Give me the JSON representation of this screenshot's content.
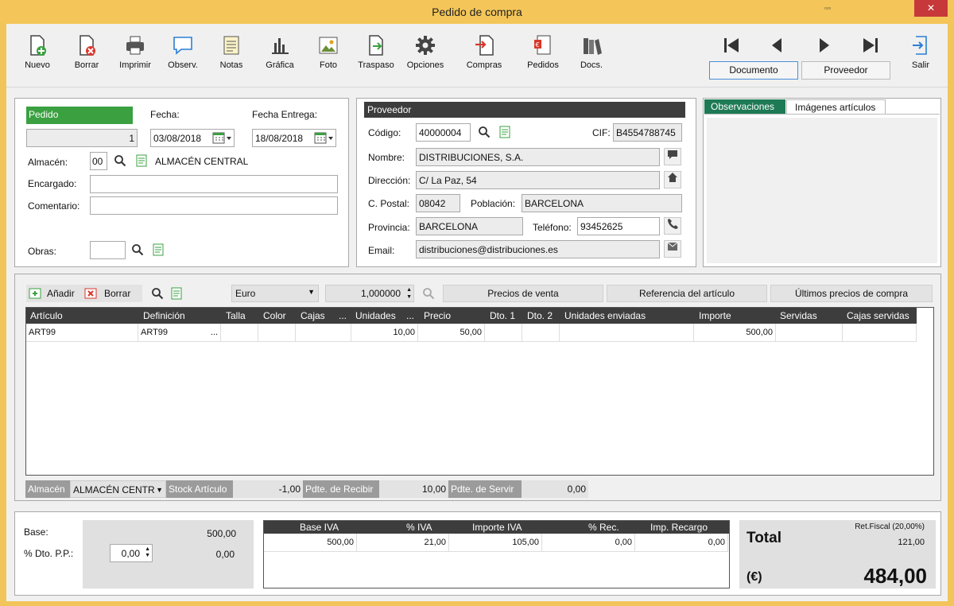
{
  "window": {
    "title": "Pedido de compra",
    "restore_glyph": "▫▫▫",
    "close_glyph": "✕"
  },
  "toolbar": {
    "items": [
      {
        "label": "Nuevo",
        "icon": "new-document-icon"
      },
      {
        "label": "Borrar",
        "icon": "delete-document-icon"
      },
      {
        "label": "Imprimir",
        "icon": "printer-icon"
      },
      {
        "label": "Observ.",
        "icon": "speech-bubble-icon"
      },
      {
        "label": "Notas",
        "icon": "notes-icon"
      },
      {
        "label": "Gráfica",
        "icon": "bar-chart-icon"
      },
      {
        "label": "Foto",
        "icon": "photo-icon"
      },
      {
        "label": "Traspaso",
        "icon": "transfer-icon"
      },
      {
        "label": "Opciones",
        "icon": "gear-icon"
      },
      {
        "label": "Compras",
        "icon": "purchases-icon"
      },
      {
        "label": "Pedidos",
        "icon": "orders-icon"
      },
      {
        "label": "Docs.",
        "icon": "books-icon"
      }
    ],
    "nav_mode": {
      "documento": "Documento",
      "proveedor": "Proveedor"
    },
    "exit_label": "Salir"
  },
  "pedido": {
    "header": "Pedido",
    "number": "1",
    "fecha_label": "Fecha:",
    "fecha": "03/08/2018",
    "fecha_entrega_label": "Fecha Entrega:",
    "fecha_entrega": "18/08/2018",
    "almacen_label": "Almacén:",
    "almacen_code": "00",
    "almacen_name": "ALMACÉN CENTRAL",
    "encargado_label": "Encargado:",
    "encargado": "",
    "comentario_label": "Comentario:",
    "comentario": "",
    "obras_label": "Obras:",
    "obras": ""
  },
  "proveedor": {
    "header": "Proveedor",
    "codigo_label": "Código:",
    "codigo": "40000004",
    "cif_label": "CIF:",
    "cif": "B4554788745",
    "nombre_label": "Nombre:",
    "nombre": "DISTRIBUCIONES, S.A.",
    "direccion_label": "Dirección:",
    "direccion": "C/ La Paz, 54",
    "cpostal_label": "C. Postal:",
    "cpostal": "08042",
    "poblacion_label": "Población:",
    "poblacion": "BARCELONA",
    "provincia_label": "Provincia:",
    "provincia": "BARCELONA",
    "telefono_label": "Teléfono:",
    "telefono": "93452625",
    "email_label": "Email:",
    "email": "distribuciones@distribuciones.es"
  },
  "obs_tabs": {
    "observaciones": "Observaciones",
    "imagenes": "Imágenes artículos"
  },
  "lines_toolbar": {
    "add": "Añadir",
    "delete": "Borrar",
    "currency": "Euro",
    "rate": "1,000000",
    "precios_venta": "Precios de venta",
    "referencia": "Referencia del artículo",
    "ultimos_precios": "Últimos precios de compra"
  },
  "grid": {
    "columns": [
      "Artículo",
      "Definición",
      "Talla",
      "Color",
      "Cajas",
      "...",
      "Unidades",
      "...",
      "Precio",
      "Dto. 1",
      "Dto. 2",
      "Unidades enviadas",
      "Importe",
      "Servidas",
      "Cajas servidas"
    ],
    "rows": [
      {
        "articulo": "ART99",
        "definicion": "ART99",
        "more": "...",
        "unidades": "10,00",
        "precio": "50,00",
        "importe": "500,00"
      }
    ]
  },
  "stock_bar": {
    "almacen_label": "Almacén",
    "almacen_value": "ALMACÉN CENTR",
    "stock_label": "Stock Artículo",
    "stock_value": "-1,00",
    "pdte_recibir_label": "Pdte. de Recibir",
    "pdte_recibir_value": "10,00",
    "pdte_servir_label": "Pdte. de Servir",
    "pdte_servir_value": "0,00"
  },
  "totals": {
    "base_label": "Base:",
    "base_value": "500,00",
    "dto_label": "% Dto. P.P.:",
    "dto_input": "0,00",
    "dto_value": "0,00",
    "iva_columns": [
      "Base IVA",
      "% IVA",
      "Importe IVA",
      "% Rec.",
      "Imp. Recargo"
    ],
    "iva_row": [
      "500,00",
      "21,00",
      "105,00",
      "0,00",
      "0,00"
    ],
    "total_label": "Total",
    "currency_label": "(€)",
    "ret_fiscal_label": "Ret.Fiscal (20,00%)",
    "ret_fiscal_value": "121,00",
    "total_value": "484,00"
  },
  "colors": {
    "accent_green": "#3aa040",
    "tab_green": "#1e7a55",
    "header_dark": "#3d3d3d",
    "frame": "#f2c55a"
  }
}
